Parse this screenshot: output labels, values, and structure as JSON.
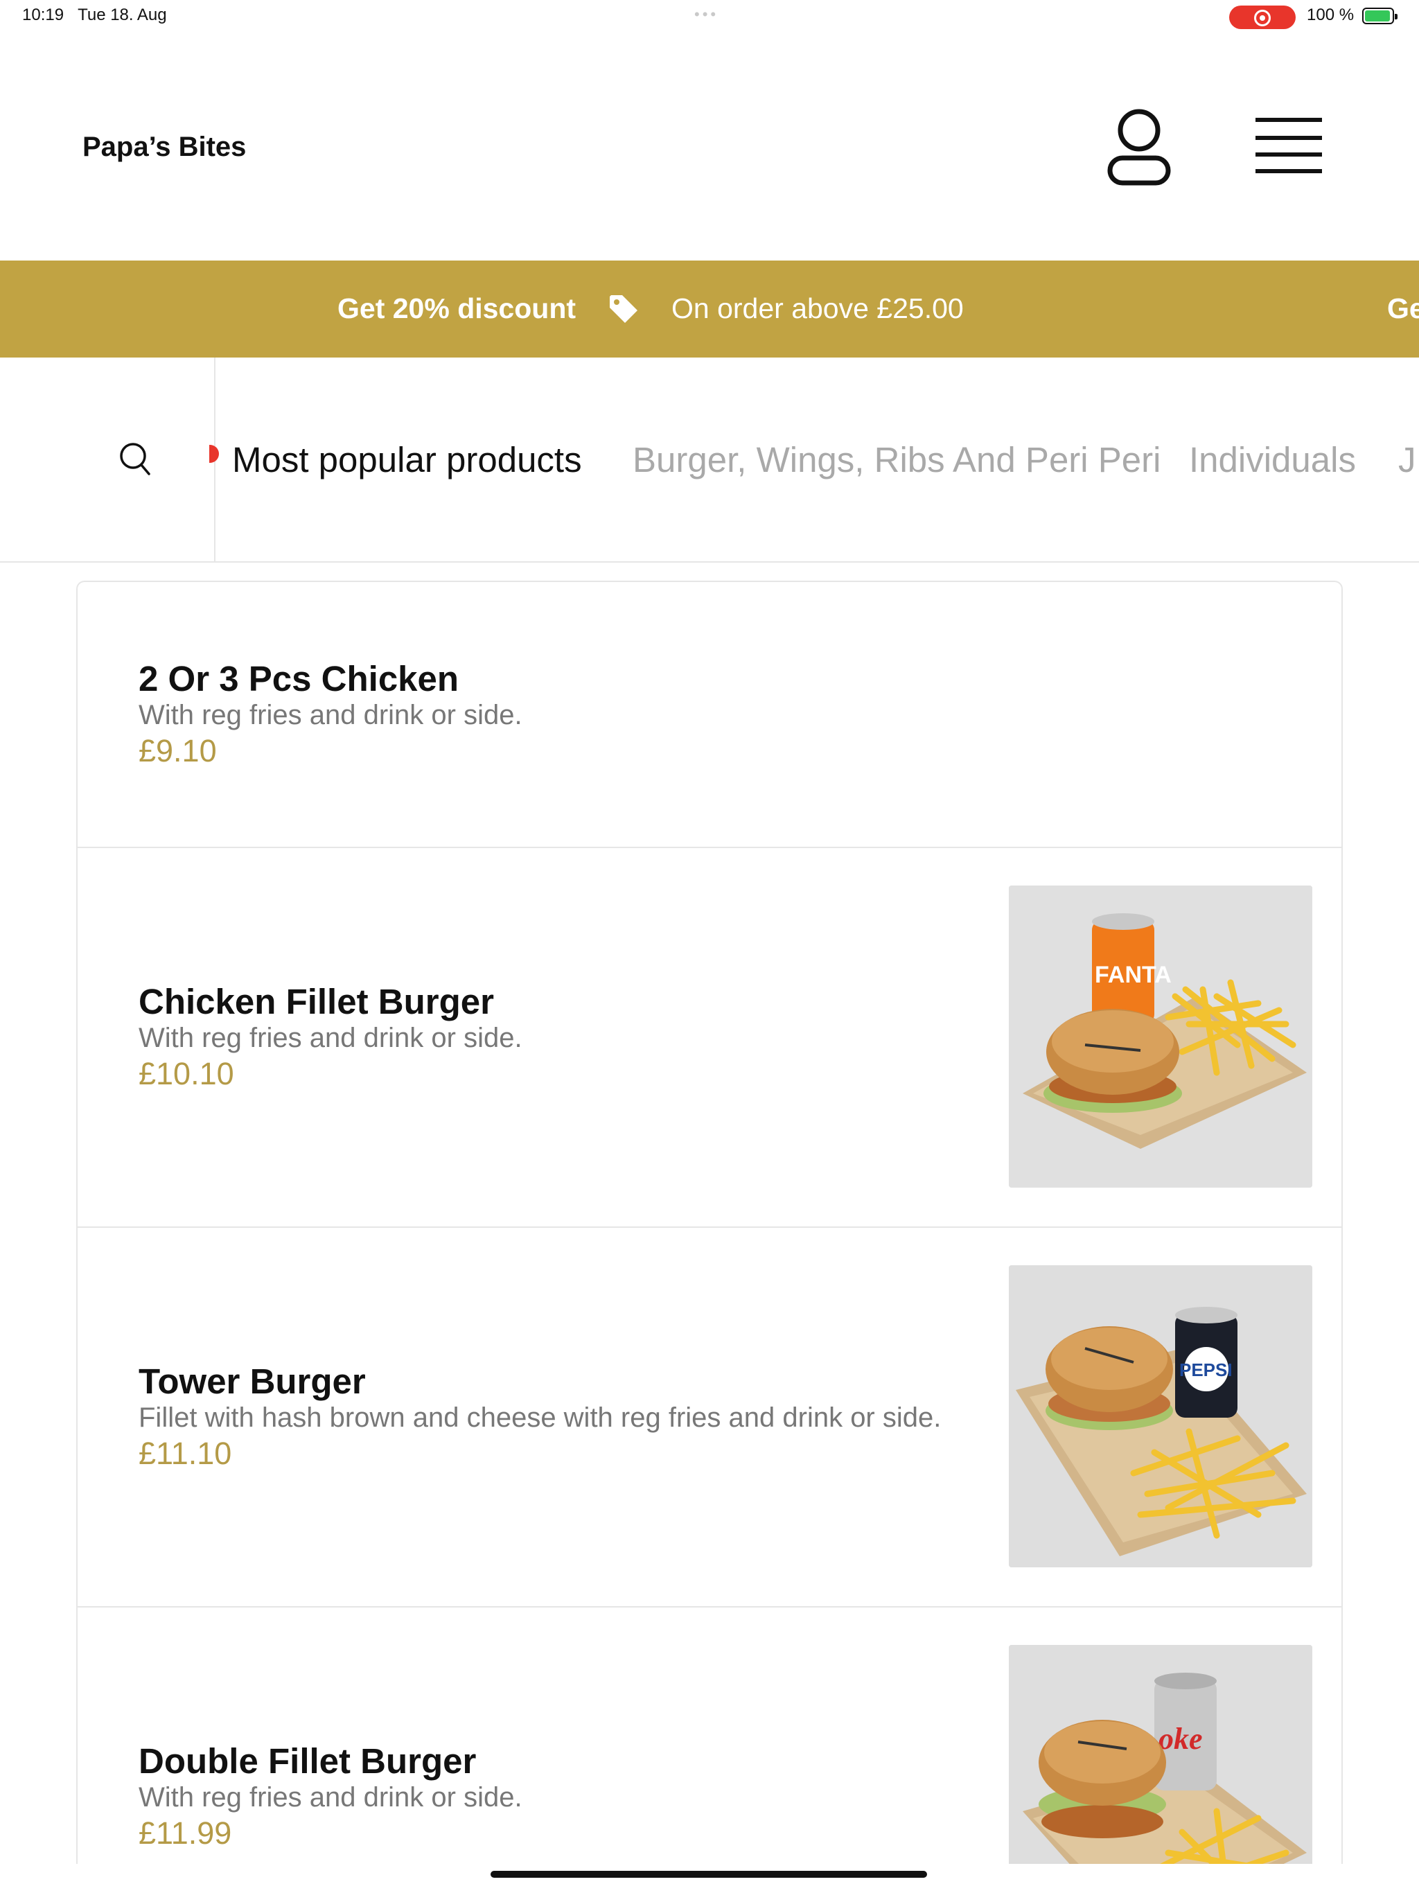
{
  "status_bar": {
    "time": "10:19",
    "date": "Tue 18. Aug",
    "battery": "100 %",
    "recording_color": "#e8352b",
    "battery_color": "#34c759"
  },
  "header": {
    "brand": "Papa’s Bites",
    "account_icon": "user-icon",
    "menu_icon": "hamburger-menu-icon"
  },
  "banner": {
    "discount": "Get 20% discount",
    "condition": "On order above £25.00",
    "repeat_fragment": "Ge",
    "background": "#c1a343",
    "icon": "tag-icon"
  },
  "categories": {
    "search_icon": "search-icon",
    "items": [
      {
        "label": "Most popular products",
        "active": true
      },
      {
        "label": "Burger, Wings, Ribs And Peri Peri",
        "active": false
      },
      {
        "label": "Individuals",
        "active": false
      },
      {
        "label": "J",
        "active": false
      }
    ]
  },
  "products": [
    {
      "name": "2 Or 3 Pcs Chicken",
      "description": "With reg fries and drink or side.",
      "price": "£9.10",
      "has_image": false
    },
    {
      "name": "Chicken Fillet Burger",
      "description": "With reg fries and drink or side.",
      "price": "£10.10",
      "has_image": true,
      "can_label": "FANTA",
      "can_color": "#f07a1a"
    },
    {
      "name": "Tower Burger",
      "description": "Fillet with hash brown and cheese with reg fries and drink or side.",
      "price": "£11.10",
      "has_image": true,
      "can_label": "PEPSI",
      "can_color": "#1b1f2a"
    },
    {
      "name": "Double Fillet Burger",
      "description": "With reg fries and drink or side.",
      "price": "£11.99",
      "has_image": true,
      "can_label": "oke",
      "can_color": "#c8c8c8"
    }
  ],
  "accent_color": "#b49a47"
}
